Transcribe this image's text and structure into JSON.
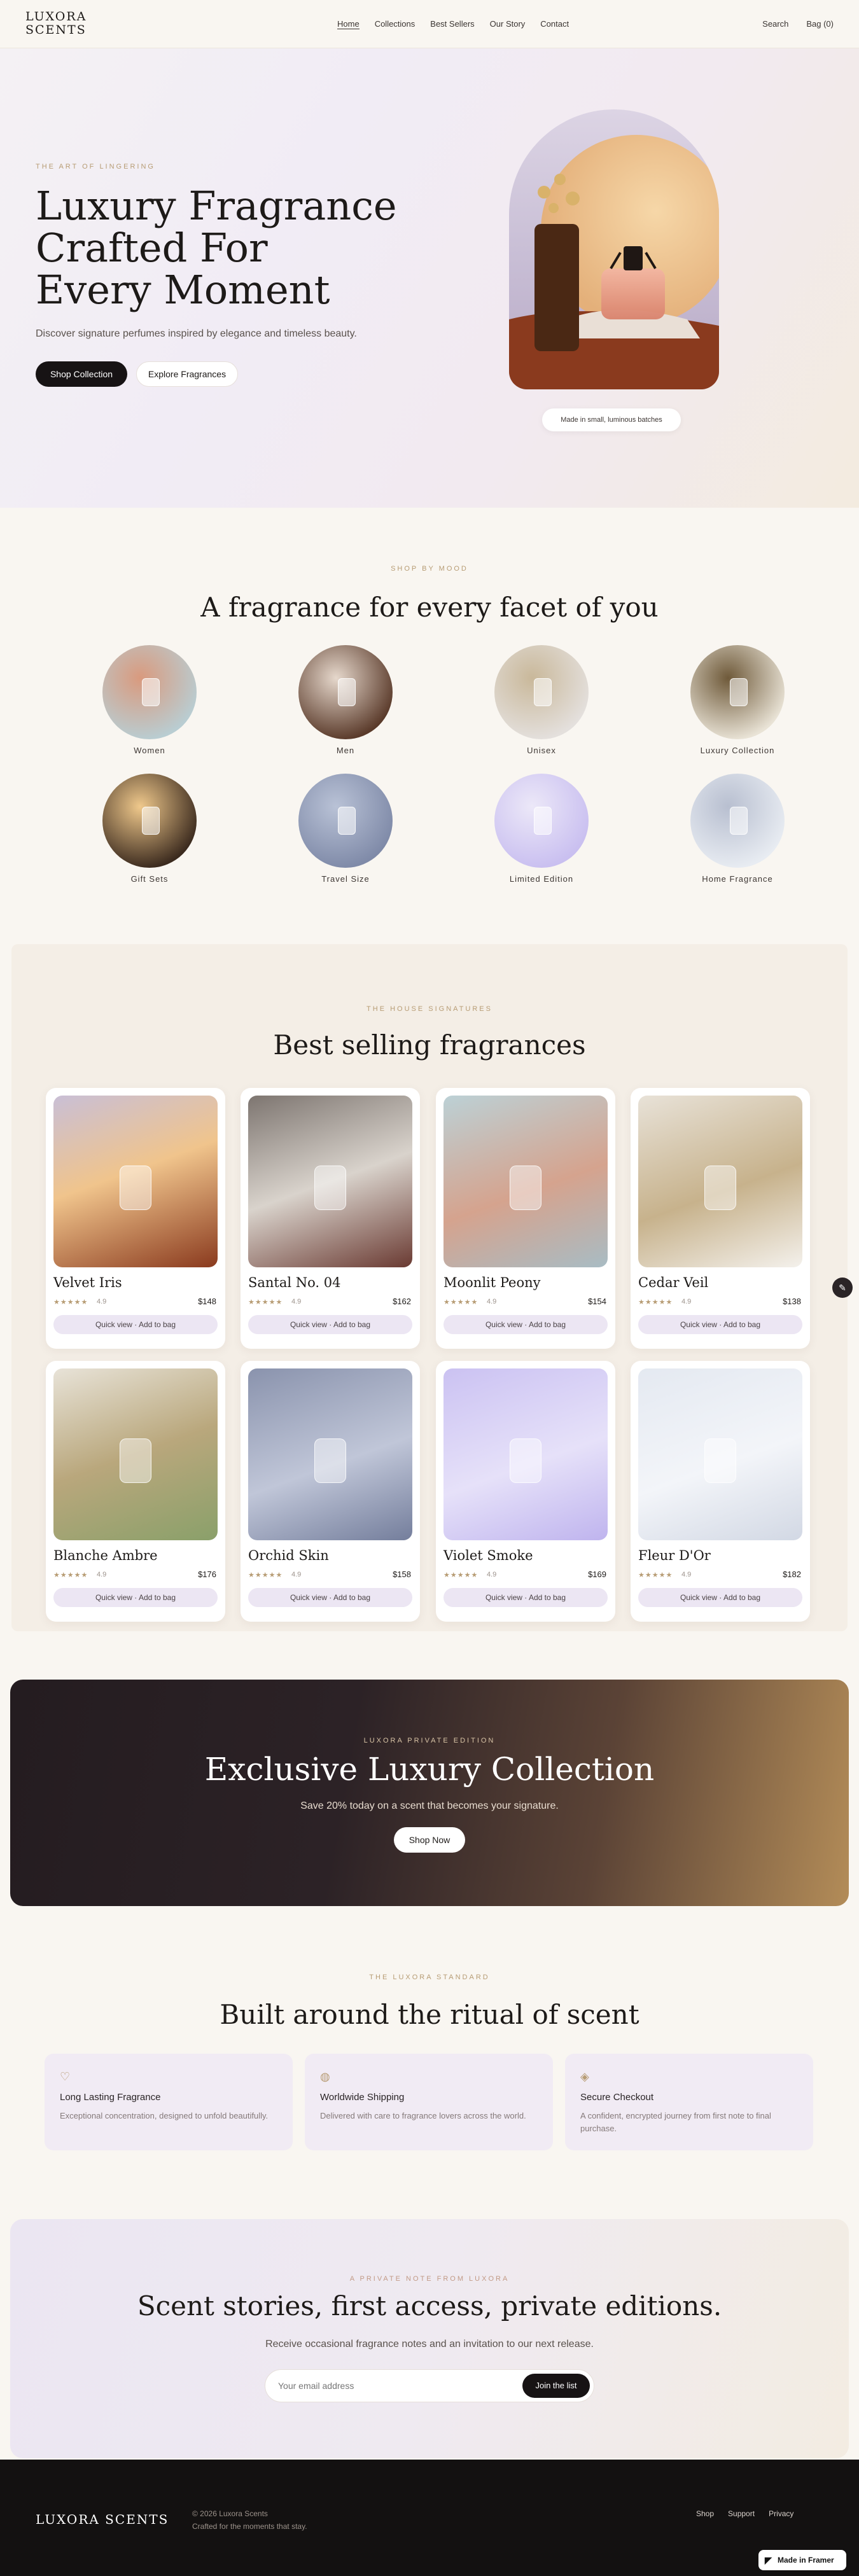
{
  "nav": {
    "logo_line1": "LUXORA",
    "logo_line2": "SCENTS",
    "links": [
      "Home",
      "Collections",
      "Best Sellers",
      "Our Story",
      "Contact"
    ],
    "search": "Search",
    "bag": "Bag (0)"
  },
  "hero": {
    "eyebrow": "THE ART OF LINGERING",
    "title_line1": "Luxury Fragrance",
    "title_line2": "Crafted For",
    "title_line3": "Every Moment",
    "subtitle": "Discover signature perfumes inspired by elegance and timeless beauty.",
    "primary_cta": "Shop Collection",
    "secondary_cta": "Explore Fragrances",
    "badge": "Made in small, luminous batches"
  },
  "moods": {
    "eyebrow": "SHOP BY MOOD",
    "title": "A fragrance for every facet of you",
    "items": [
      "Women",
      "Men",
      "Unisex",
      "Luxury Collection",
      "Gift Sets",
      "Travel Size",
      "Limited Edition",
      "Home Fragrance"
    ]
  },
  "best": {
    "eyebrow": "THE HOUSE SIGNATURES",
    "title": "Best selling fragrances",
    "stars": "★★★★★",
    "quick_label": "Quick view · Add to bag",
    "products": [
      {
        "name": "Velvet Iris",
        "rating": "4.9",
        "price": "$148"
      },
      {
        "name": "Santal No. 04",
        "rating": "4.9",
        "price": "$162"
      },
      {
        "name": "Moonlit Peony",
        "rating": "4.9",
        "price": "$154"
      },
      {
        "name": "Cedar Veil",
        "rating": "4.9",
        "price": "$138"
      },
      {
        "name": "Blanche Ambre",
        "rating": "4.9",
        "price": "$176"
      },
      {
        "name": "Orchid Skin",
        "rating": "4.9",
        "price": "$158"
      },
      {
        "name": "Violet Smoke",
        "rating": "4.9",
        "price": "$169"
      },
      {
        "name": "Fleur D'Or",
        "rating": "4.9",
        "price": "$182"
      }
    ]
  },
  "promo": {
    "eyebrow": "LUXORA PRIVATE EDITION",
    "title": "Exclusive Luxury Collection",
    "subtitle": "Save 20% today on a scent that becomes your signature.",
    "cta": "Shop Now"
  },
  "ritual": {
    "eyebrow": "THE LUXORA STANDARD",
    "title": "Built around the ritual of scent",
    "features": [
      {
        "title": "Long Lasting Fragrance",
        "desc": "Exceptional concentration, designed to unfold beautifully."
      },
      {
        "title": "Worldwide Shipping",
        "desc": "Delivered with care to fragrance lovers across the world."
      },
      {
        "title": "Secure Checkout",
        "desc": "A confident, encrypted journey from first note to final purchase."
      }
    ]
  },
  "newsletter": {
    "eyebrow": "A PRIVATE NOTE FROM LUXORA",
    "title": "Scent stories, first access, private editions.",
    "subtitle": "Receive occasional fragrance notes and an invitation to our next release.",
    "placeholder": "Your email address",
    "cta": "Join the list"
  },
  "footer": {
    "logo": "LUXORA SCENTS",
    "copyright": "© 2026 Luxora Scents",
    "tagline": "Crafted for the moments that stay.",
    "links": [
      "Shop",
      "Support",
      "Privacy"
    ],
    "framer_badge": "Made in Framer"
  },
  "colors": {
    "accent_gold": "#b79c74",
    "dark": "#171314",
    "lavender": "#ece6f3",
    "cream": "#f9f6f1"
  }
}
